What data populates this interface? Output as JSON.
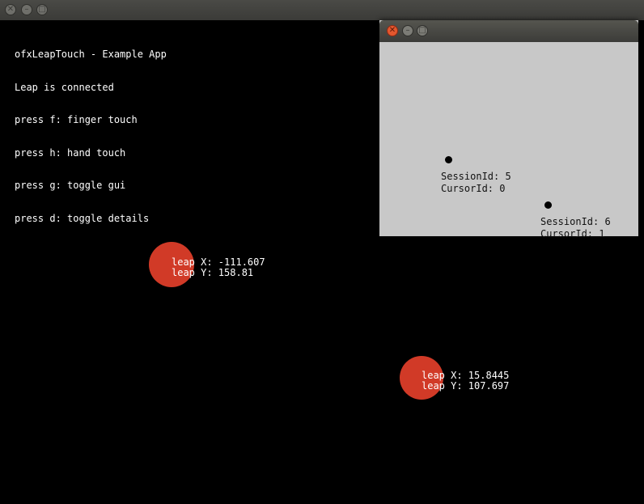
{
  "main_window": {
    "buttons": {
      "close": "✕",
      "minimize": "–",
      "maximize": "□"
    }
  },
  "info_lines": [
    "ofxLeapTouch - Example App",
    "Leap is connected",
    "press f: finger touch",
    "press h: hand touch",
    "press g: toggle gui",
    "press d: toggle details"
  ],
  "touch_points": [
    {
      "x_label": "leap X: -111.607",
      "y_label": "leap Y: 158.81"
    },
    {
      "x_label": "leap X: 15.8445",
      "y_label": "leap Y: 107.697"
    }
  ],
  "gui_window": {
    "buttons": {
      "close": "✕",
      "minimize": "–",
      "maximize": "□"
    },
    "cursors": [
      {
        "session": "SessionId: 5",
        "cursor": "CursorId: 0"
      },
      {
        "session": "SessionId: 6",
        "cursor": "CursorId: 1"
      }
    ]
  },
  "colors": {
    "touch": "#d13a27",
    "gui_background": "#c8c8c8",
    "canvas": "#000000"
  }
}
